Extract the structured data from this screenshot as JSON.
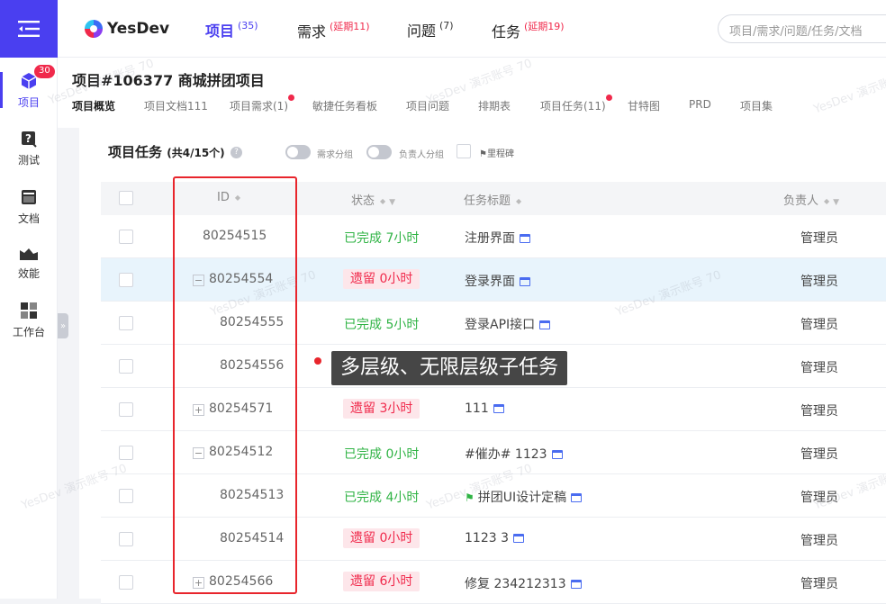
{
  "sidebar": {
    "badge": "30",
    "items": [
      {
        "label": "项目",
        "icon": "cube-icon"
      },
      {
        "label": "测试",
        "icon": "test-icon"
      },
      {
        "label": "文档",
        "icon": "document-icon"
      },
      {
        "label": "效能",
        "icon": "chart-icon"
      },
      {
        "label": "工作台",
        "icon": "dashboard-icon"
      }
    ]
  },
  "topnav": {
    "logo": "YesDev",
    "items": [
      {
        "label": "项目",
        "sup": "(35)"
      },
      {
        "label": "需求",
        "sup": "(延期11)"
      },
      {
        "label": "问题",
        "sup": "(7)"
      },
      {
        "label": "任务",
        "sup": "(延期19)"
      }
    ],
    "search_placeholder": "项目/需求/问题/任务/文档"
  },
  "project": {
    "title": "项目#106377 商城拼团项目",
    "tabs": [
      "项目概览",
      "项目文档111",
      "项目需求(1)",
      "敏捷任务看板",
      "项目问题",
      "排期表",
      "项目任务(11)",
      "甘特图",
      "PRD",
      "项目集"
    ]
  },
  "panel": {
    "title": "项目任务",
    "count": "(共4/15个)",
    "toggle1": "需求分组",
    "toggle2": "负责人分组",
    "milestone": "里程碑"
  },
  "table": {
    "headers": {
      "id": "ID",
      "status": "状态",
      "title": "任务标题",
      "owner": "负责人"
    },
    "rows": [
      {
        "id": "80254515",
        "status": "已完成 7小时",
        "status_type": "done",
        "title": "注册界面",
        "owner": "管理员",
        "level": 0,
        "expander": ""
      },
      {
        "id": "80254554",
        "status": "遗留 0小时",
        "status_type": "late",
        "title": "登录界面",
        "owner": "管理员",
        "level": 0,
        "expander": "−"
      },
      {
        "id": "80254555",
        "status": "已完成 5小时",
        "status_type": "done",
        "title": "登录API接口",
        "owner": "管理员",
        "level": 1,
        "expander": ""
      },
      {
        "id": "80254556",
        "status": "",
        "status_type": "none",
        "title": "",
        "owner": "管理员",
        "level": 1,
        "expander": ""
      },
      {
        "id": "80254571",
        "status": "遗留 3小时",
        "status_type": "late",
        "title": "111",
        "owner": "管理员",
        "level": 0,
        "expander": "+"
      },
      {
        "id": "80254512",
        "status": "已完成 0小时",
        "status_type": "done",
        "title": "#催办# 1123",
        "owner": "管理员",
        "level": 0,
        "expander": "−"
      },
      {
        "id": "80254513",
        "status": "已完成 4小时",
        "status_type": "done",
        "title": "拼团UI设计定稿",
        "owner": "管理员",
        "level": 1,
        "expander": "",
        "flag": true
      },
      {
        "id": "80254514",
        "status": "遗留 0小时",
        "status_type": "late",
        "title": "1123 3",
        "owner": "管理员",
        "level": 1,
        "expander": ""
      },
      {
        "id": "80254566",
        "status": "遗留 6小时",
        "status_type": "late",
        "title": "修复 234212313",
        "owner": "管理员",
        "level": 0,
        "expander": "+"
      }
    ]
  },
  "tooltip": "多层级、无限层级子任务",
  "watermark": "YesDev 演示账号 70",
  "colors": {
    "brand": "#4a3ff0",
    "done": "#2fb344",
    "late": "#f0294b",
    "highlight_row": "#e8f4fc",
    "frame": "#e8252c"
  }
}
